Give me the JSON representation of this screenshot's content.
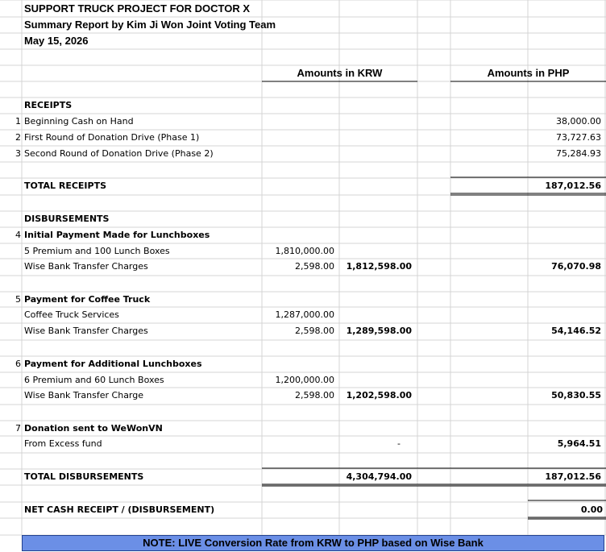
{
  "title": {
    "line1": "SUPPORT TRUCK PROJECT FOR DOCTOR X",
    "line2": "Summary Report by Kim Ji Won Joint Voting Team",
    "date": "May 15, 2026"
  },
  "headers": {
    "krw": "Amounts in KRW",
    "php": "Amounts in PHP"
  },
  "receipts": {
    "heading": "RECEIPTS",
    "items": [
      {
        "num": "1",
        "label": "Beginning Cash on Hand",
        "php": "38,000.00"
      },
      {
        "num": "2",
        "label": "First Round of Donation Drive (Phase 1)",
        "php": "73,727.63"
      },
      {
        "num": "3",
        "label": "Second Round of Donation Drive (Phase 2)",
        "php": "75,284.93"
      }
    ],
    "total_label": "TOTAL RECEIPTS",
    "total_php": "187,012.56"
  },
  "disbursements": {
    "heading": "DISBURSEMENTS",
    "groups": [
      {
        "num": "4",
        "title": "Initial Payment Made for Lunchboxes",
        "line1_label": "5 Premium and 100 Lunch Boxes",
        "line1_krw": "1,810,000.00",
        "line2_label": "Wise Bank Transfer Charges",
        "line2_krw": "2,598.00",
        "subtotal_krw": "1,812,598.00",
        "php": "76,070.98"
      },
      {
        "num": "5",
        "title": "Payment for Coffee Truck",
        "line1_label": "Coffee Truck Services",
        "line1_krw": "1,287,000.00",
        "line2_label": "Wise Bank Transfer Charges",
        "line2_krw": "2,598.00",
        "subtotal_krw": "1,289,598.00",
        "php": "54,146.52"
      },
      {
        "num": "6",
        "title": "Payment for Additional Lunchboxes",
        "line1_label": "6 Premium and 60 Lunch Boxes",
        "line1_krw": "1,200,000.00",
        "line2_label": "Wise Bank Transfer Charge",
        "line2_krw": "2,598.00",
        "subtotal_krw": "1,202,598.00",
        "php": "50,830.55"
      }
    ],
    "donation": {
      "num": "7",
      "title": "Donation sent to WeWonVN",
      "line_label": "From Excess fund",
      "krw": "-",
      "php": "5,964.51"
    },
    "total_label": "TOTAL DISBURSEMENTS",
    "total_krw": "4,304,794.00",
    "total_php": "187,012.56"
  },
  "net": {
    "label": "NET CASH RECEIPT / (DISBURSEMENT)",
    "php": "0.00"
  },
  "note": {
    "text": "NOTE: LIVE Conversion Rate from KRW to PHP based on Wise Bank",
    "bg": "#6B8FE6",
    "border": "#1F3F8F"
  },
  "colors": {
    "grid": "#D4D4D4",
    "text": "#000000"
  }
}
